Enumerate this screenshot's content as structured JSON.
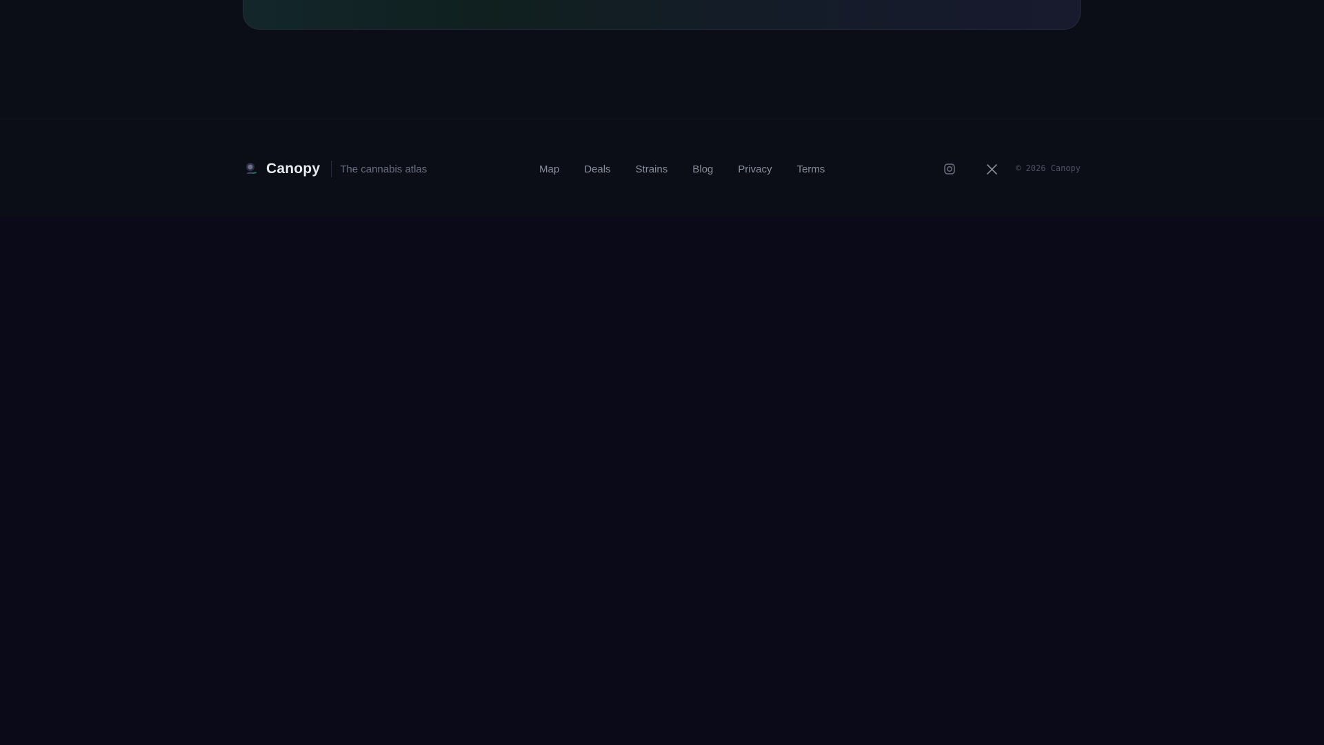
{
  "brand": {
    "name": "Canopy",
    "tagline": "The cannabis atlas"
  },
  "footer_nav": [
    {
      "label": "Map"
    },
    {
      "label": "Deals"
    },
    {
      "label": "Strains"
    },
    {
      "label": "Blog"
    },
    {
      "label": "Privacy"
    },
    {
      "label": "Terms"
    }
  ],
  "social": [
    {
      "icon": "instagram-icon"
    },
    {
      "icon": "x-icon"
    }
  ],
  "copyright": "© 2026 Canopy",
  "colors": {
    "background": "#0a0a18",
    "footer_background": "#0c0e17",
    "brand_text": "#e8e9ef",
    "nav_text": "#8a8d9c",
    "muted_text": "#6c6f80"
  }
}
